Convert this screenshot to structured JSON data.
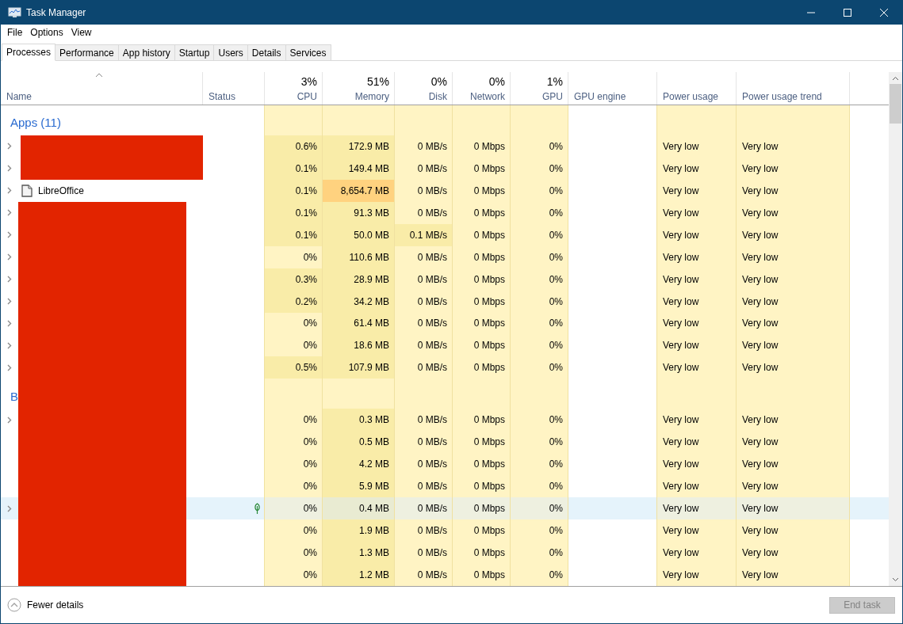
{
  "window": {
    "title": "Task Manager"
  },
  "menu": [
    "File",
    "Options",
    "View"
  ],
  "tabs": [
    {
      "label": "Processes",
      "selected": true
    },
    {
      "label": "Performance",
      "selected": false
    },
    {
      "label": "App history",
      "selected": false
    },
    {
      "label": "Startup",
      "selected": false
    },
    {
      "label": "Users",
      "selected": false
    },
    {
      "label": "Details",
      "selected": false
    },
    {
      "label": "Services",
      "selected": false
    }
  ],
  "columns": [
    {
      "label": "Name",
      "sorted": true
    },
    {
      "label": "Status",
      "sorted": false
    },
    {
      "label": "CPU",
      "total": "3%",
      "sorted": false
    },
    {
      "label": "Memory",
      "total": "51%",
      "sorted": false
    },
    {
      "label": "Disk",
      "total": "0%",
      "sorted": false
    },
    {
      "label": "Network",
      "total": "0%",
      "sorted": false
    },
    {
      "label": "GPU",
      "total": "1%",
      "sorted": false
    },
    {
      "label": "GPU engine",
      "sorted": false
    },
    {
      "label": "Power usage",
      "sorted": false
    },
    {
      "label": "Power usage trend",
      "sorted": false
    }
  ],
  "rows": [
    {
      "kind": "group",
      "label": "Apps (11)",
      "redacted": false
    },
    {
      "kind": "process",
      "expandable": true,
      "redacted": true,
      "wide": true,
      "has_icon": false,
      "selected": false,
      "efficiency": false,
      "cells": [
        {
          "text": "0.6%",
          "color": "#f9eca8"
        },
        {
          "text": "172.9 MB",
          "color": "#f9eca8"
        },
        {
          "text": "0 MB/s",
          "color": "#fff4c4"
        },
        {
          "text": "0 Mbps",
          "color": "#fff4c4"
        },
        {
          "text": "0%",
          "color": "#fff4c4"
        },
        {
          "text": "Very low",
          "color": "#fff4c4"
        },
        {
          "text": "Very low",
          "color": "#fff4c4"
        }
      ]
    },
    {
      "kind": "process",
      "expandable": true,
      "redacted": true,
      "wide": true,
      "has_icon": false,
      "selected": false,
      "efficiency": false,
      "cells": [
        {
          "text": "0.1%",
          "color": "#f9eca8"
        },
        {
          "text": "149.4 MB",
          "color": "#f9eca8"
        },
        {
          "text": "0 MB/s",
          "color": "#fff4c4"
        },
        {
          "text": "0 Mbps",
          "color": "#fff4c4"
        },
        {
          "text": "0%",
          "color": "#fff4c4"
        },
        {
          "text": "Very low",
          "color": "#fff4c4"
        },
        {
          "text": "Very low",
          "color": "#fff4c4"
        }
      ]
    },
    {
      "kind": "process",
      "expandable": true,
      "name": "LibreOffice",
      "has_icon": true,
      "redacted": false,
      "selected": false,
      "efficiency": false,
      "cells": [
        {
          "text": "0.1%",
          "color": "#f9eca8"
        },
        {
          "text": "8,654.7 MB",
          "color": "#ffd27f"
        },
        {
          "text": "0 MB/s",
          "color": "#fff4c4"
        },
        {
          "text": "0 Mbps",
          "color": "#fff4c4"
        },
        {
          "text": "0%",
          "color": "#fff4c4"
        },
        {
          "text": "Very low",
          "color": "#fff4c4"
        },
        {
          "text": "Very low",
          "color": "#fff4c4"
        }
      ]
    },
    {
      "kind": "process",
      "expandable": true,
      "redacted": true,
      "wide": false,
      "has_icon": false,
      "selected": false,
      "efficiency": false,
      "cells": [
        {
          "text": "0.1%",
          "color": "#f9eca8"
        },
        {
          "text": "91.3 MB",
          "color": "#f9eca8"
        },
        {
          "text": "0 MB/s",
          "color": "#fff4c4"
        },
        {
          "text": "0 Mbps",
          "color": "#fff4c4"
        },
        {
          "text": "0%",
          "color": "#fff4c4"
        },
        {
          "text": "Very low",
          "color": "#fff4c4"
        },
        {
          "text": "Very low",
          "color": "#fff4c4"
        }
      ]
    },
    {
      "kind": "process",
      "expandable": true,
      "redacted": true,
      "wide": false,
      "has_icon": false,
      "selected": false,
      "efficiency": false,
      "cells": [
        {
          "text": "0.1%",
          "color": "#f9eca8"
        },
        {
          "text": "50.0 MB",
          "color": "#f9eca8"
        },
        {
          "text": "0.1 MB/s",
          "color": "#f9eca8"
        },
        {
          "text": "0 Mbps",
          "color": "#fff4c4"
        },
        {
          "text": "0%",
          "color": "#fff4c4"
        },
        {
          "text": "Very low",
          "color": "#fff4c4"
        },
        {
          "text": "Very low",
          "color": "#fff4c4"
        }
      ]
    },
    {
      "kind": "process",
      "expandable": true,
      "redacted": true,
      "wide": false,
      "has_icon": false,
      "selected": false,
      "efficiency": false,
      "cells": [
        {
          "text": "0%",
          "color": "#fff4c4"
        },
        {
          "text": "110.6 MB",
          "color": "#f9eca8"
        },
        {
          "text": "0 MB/s",
          "color": "#fff4c4"
        },
        {
          "text": "0 Mbps",
          "color": "#fff4c4"
        },
        {
          "text": "0%",
          "color": "#fff4c4"
        },
        {
          "text": "Very low",
          "color": "#fff4c4"
        },
        {
          "text": "Very low",
          "color": "#fff4c4"
        }
      ]
    },
    {
      "kind": "process",
      "expandable": true,
      "redacted": true,
      "wide": false,
      "has_icon": false,
      "selected": false,
      "efficiency": false,
      "cells": [
        {
          "text": "0.3%",
          "color": "#f9eca8"
        },
        {
          "text": "28.9 MB",
          "color": "#f9eca8"
        },
        {
          "text": "0 MB/s",
          "color": "#fff4c4"
        },
        {
          "text": "0 Mbps",
          "color": "#fff4c4"
        },
        {
          "text": "0%",
          "color": "#fff4c4"
        },
        {
          "text": "Very low",
          "color": "#fff4c4"
        },
        {
          "text": "Very low",
          "color": "#fff4c4"
        }
      ]
    },
    {
      "kind": "process",
      "expandable": true,
      "redacted": true,
      "wide": false,
      "has_icon": false,
      "selected": false,
      "efficiency": false,
      "cells": [
        {
          "text": "0.2%",
          "color": "#f9eca8"
        },
        {
          "text": "34.2 MB",
          "color": "#f9eca8"
        },
        {
          "text": "0 MB/s",
          "color": "#fff4c4"
        },
        {
          "text": "0 Mbps",
          "color": "#fff4c4"
        },
        {
          "text": "0%",
          "color": "#fff4c4"
        },
        {
          "text": "Very low",
          "color": "#fff4c4"
        },
        {
          "text": "Very low",
          "color": "#fff4c4"
        }
      ]
    },
    {
      "kind": "process",
      "expandable": true,
      "redacted": true,
      "wide": false,
      "has_icon": false,
      "selected": false,
      "efficiency": false,
      "cells": [
        {
          "text": "0%",
          "color": "#fff4c4"
        },
        {
          "text": "61.4 MB",
          "color": "#f9eca8"
        },
        {
          "text": "0 MB/s",
          "color": "#fff4c4"
        },
        {
          "text": "0 Mbps",
          "color": "#fff4c4"
        },
        {
          "text": "0%",
          "color": "#fff4c4"
        },
        {
          "text": "Very low",
          "color": "#fff4c4"
        },
        {
          "text": "Very low",
          "color": "#fff4c4"
        }
      ]
    },
    {
      "kind": "process",
      "expandable": true,
      "redacted": true,
      "wide": false,
      "has_icon": false,
      "selected": false,
      "efficiency": false,
      "cells": [
        {
          "text": "0%",
          "color": "#fff4c4"
        },
        {
          "text": "18.6 MB",
          "color": "#f9eca8"
        },
        {
          "text": "0 MB/s",
          "color": "#fff4c4"
        },
        {
          "text": "0 Mbps",
          "color": "#fff4c4"
        },
        {
          "text": "0%",
          "color": "#fff4c4"
        },
        {
          "text": "Very low",
          "color": "#fff4c4"
        },
        {
          "text": "Very low",
          "color": "#fff4c4"
        }
      ]
    },
    {
      "kind": "process",
      "expandable": true,
      "redacted": true,
      "wide": false,
      "has_icon": false,
      "selected": false,
      "efficiency": false,
      "cells": [
        {
          "text": "0.5%",
          "color": "#f9eca8"
        },
        {
          "text": "107.9 MB",
          "color": "#f9eca8"
        },
        {
          "text": "0 MB/s",
          "color": "#fff4c4"
        },
        {
          "text": "0 Mbps",
          "color": "#fff4c4"
        },
        {
          "text": "0%",
          "color": "#fff4c4"
        },
        {
          "text": "Very low",
          "color": "#fff4c4"
        },
        {
          "text": "Very low",
          "color": "#fff4c4"
        }
      ]
    },
    {
      "kind": "group",
      "label": "B",
      "redacted": true,
      "wide": false
    },
    {
      "kind": "process",
      "expandable": true,
      "redacted": true,
      "wide": false,
      "has_icon": false,
      "selected": false,
      "efficiency": false,
      "cells": [
        {
          "text": "0%",
          "color": "#fff4c4"
        },
        {
          "text": "0.3 MB",
          "color": "#f9eca8"
        },
        {
          "text": "0 MB/s",
          "color": "#fff4c4"
        },
        {
          "text": "0 Mbps",
          "color": "#fff4c4"
        },
        {
          "text": "0%",
          "color": "#fff4c4"
        },
        {
          "text": "Very low",
          "color": "#fff4c4"
        },
        {
          "text": "Very low",
          "color": "#fff4c4"
        }
      ]
    },
    {
      "kind": "process",
      "expandable": false,
      "redacted": true,
      "wide": false,
      "has_icon": false,
      "selected": false,
      "efficiency": false,
      "cells": [
        {
          "text": "0%",
          "color": "#fff4c4"
        },
        {
          "text": "0.5 MB",
          "color": "#f9eca8"
        },
        {
          "text": "0 MB/s",
          "color": "#fff4c4"
        },
        {
          "text": "0 Mbps",
          "color": "#fff4c4"
        },
        {
          "text": "0%",
          "color": "#fff4c4"
        },
        {
          "text": "Very low",
          "color": "#fff4c4"
        },
        {
          "text": "Very low",
          "color": "#fff4c4"
        }
      ]
    },
    {
      "kind": "process",
      "expandable": false,
      "redacted": true,
      "wide": false,
      "has_icon": false,
      "selected": false,
      "efficiency": false,
      "cells": [
        {
          "text": "0%",
          "color": "#fff4c4"
        },
        {
          "text": "4.2 MB",
          "color": "#f9eca8"
        },
        {
          "text": "0 MB/s",
          "color": "#fff4c4"
        },
        {
          "text": "0 Mbps",
          "color": "#fff4c4"
        },
        {
          "text": "0%",
          "color": "#fff4c4"
        },
        {
          "text": "Very low",
          "color": "#fff4c4"
        },
        {
          "text": "Very low",
          "color": "#fff4c4"
        }
      ]
    },
    {
      "kind": "process",
      "expandable": false,
      "redacted": true,
      "wide": false,
      "has_icon": false,
      "selected": false,
      "efficiency": false,
      "cells": [
        {
          "text": "0%",
          "color": "#fff4c4"
        },
        {
          "text": "5.9 MB",
          "color": "#f9eca8"
        },
        {
          "text": "0 MB/s",
          "color": "#fff4c4"
        },
        {
          "text": "0 Mbps",
          "color": "#fff4c4"
        },
        {
          "text": "0%",
          "color": "#fff4c4"
        },
        {
          "text": "Very low",
          "color": "#fff4c4"
        },
        {
          "text": "Very low",
          "color": "#fff4c4"
        }
      ]
    },
    {
      "kind": "process",
      "expandable": true,
      "redacted": true,
      "wide": false,
      "has_icon": false,
      "selected": true,
      "efficiency": true,
      "cells": [
        {
          "text": "0%",
          "color": "#eef0e0"
        },
        {
          "text": "0.4 MB",
          "color": "#e9ebd2"
        },
        {
          "text": "0 MB/s",
          "color": "#eef0e0"
        },
        {
          "text": "0 Mbps",
          "color": "#eef0e0"
        },
        {
          "text": "0%",
          "color": "#eef0e0"
        },
        {
          "text": "Very low",
          "color": "#eef0e0"
        },
        {
          "text": "Very low",
          "color": "#eef0e0"
        }
      ]
    },
    {
      "kind": "process",
      "expandable": false,
      "redacted": true,
      "wide": false,
      "has_icon": false,
      "selected": false,
      "efficiency": false,
      "cells": [
        {
          "text": "0%",
          "color": "#fff4c4"
        },
        {
          "text": "1.9 MB",
          "color": "#f9eca8"
        },
        {
          "text": "0 MB/s",
          "color": "#fff4c4"
        },
        {
          "text": "0 Mbps",
          "color": "#fff4c4"
        },
        {
          "text": "0%",
          "color": "#fff4c4"
        },
        {
          "text": "Very low",
          "color": "#fff4c4"
        },
        {
          "text": "Very low",
          "color": "#fff4c4"
        }
      ]
    },
    {
      "kind": "process",
      "expandable": false,
      "redacted": true,
      "wide": false,
      "has_icon": false,
      "selected": false,
      "efficiency": false,
      "cells": [
        {
          "text": "0%",
          "color": "#fff4c4"
        },
        {
          "text": "1.3 MB",
          "color": "#f9eca8"
        },
        {
          "text": "0 MB/s",
          "color": "#fff4c4"
        },
        {
          "text": "0 Mbps",
          "color": "#fff4c4"
        },
        {
          "text": "0%",
          "color": "#fff4c4"
        },
        {
          "text": "Very low",
          "color": "#fff4c4"
        },
        {
          "text": "Very low",
          "color": "#fff4c4"
        }
      ]
    },
    {
      "kind": "process",
      "expandable": false,
      "redacted": true,
      "wide": false,
      "has_icon": false,
      "selected": false,
      "efficiency": false,
      "cells": [
        {
          "text": "0%",
          "color": "#fff4c4"
        },
        {
          "text": "1.2 MB",
          "color": "#f9eca8"
        },
        {
          "text": "0 MB/s",
          "color": "#fff4c4"
        },
        {
          "text": "0 Mbps",
          "color": "#fff4c4"
        },
        {
          "text": "0%",
          "color": "#fff4c4"
        },
        {
          "text": "Very low",
          "color": "#fff4c4"
        },
        {
          "text": "Very low",
          "color": "#fff4c4"
        }
      ]
    }
  ],
  "footer": {
    "toggle": "Fewer details",
    "end_task": {
      "label": "End task",
      "disabled": true
    }
  }
}
